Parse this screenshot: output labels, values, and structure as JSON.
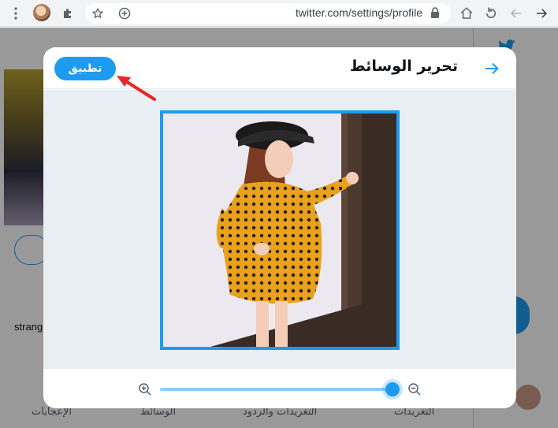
{
  "browser": {
    "url": "twitter.com/settings/profile",
    "icons": [
      "menu-dots-icon",
      "extension-avatar-icon",
      "puzzle-icon",
      "star-icon",
      "add-tab-icon",
      "lock-icon",
      "home-icon",
      "reload-icon",
      "back-icon",
      "forward-icon"
    ]
  },
  "background": {
    "left_text": "strang",
    "tabs": [
      "الإعجابات",
      "الوسائط",
      "التغريدات والردود",
      "التغريدات"
    ]
  },
  "modal": {
    "title": "تحرير الوسائط",
    "apply_label": "تطبيق",
    "zoom": {
      "value_fraction": 1.0
    }
  },
  "colors": {
    "accent": "#1d9bf0",
    "annotation": "#e8262a"
  }
}
